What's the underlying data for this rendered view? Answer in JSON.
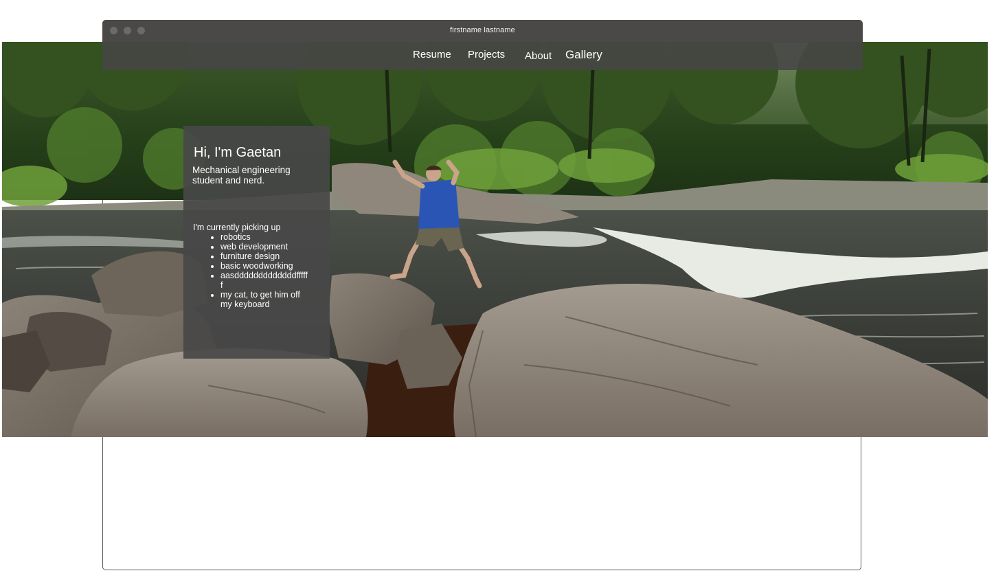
{
  "window": {
    "title": "firstname lastname"
  },
  "nav": {
    "items": [
      {
        "label": "Resume"
      },
      {
        "label": "Projects"
      },
      {
        "label": "About"
      },
      {
        "label": "Gallery"
      }
    ]
  },
  "intro": {
    "heading": "Hi, I'm Gaetan",
    "subtitle": "Mechanical engineering student and nerd.",
    "lead": "I'm currently picking up",
    "list": [
      "robotics",
      "web development",
      "furniture design",
      "basic woodworking",
      "aasdddddddddddddffffff",
      "my cat, to get him off my keyboard"
    ]
  },
  "hero": {
    "image_icon": "river-rocks-photo",
    "colors": {
      "forest": "#2f4a1f",
      "water": "#3b3f3a",
      "rock": "#8f857a",
      "shirt": "#2a55b5"
    }
  },
  "colors": {
    "chrome": "#4a4948",
    "navbar": "#464646",
    "card": "#484848",
    "text": "#ffffff"
  }
}
